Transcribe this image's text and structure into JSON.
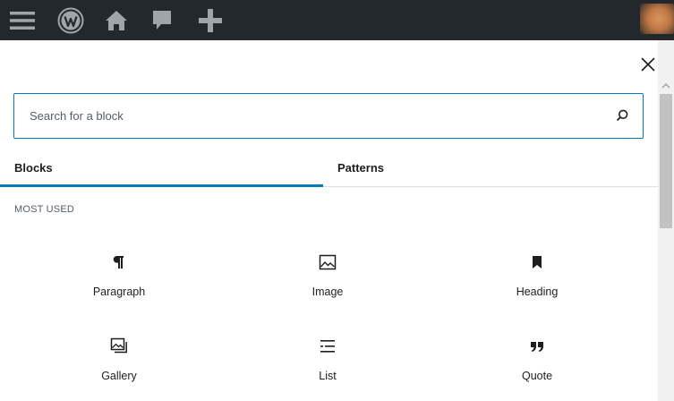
{
  "admin_bar": {
    "icons": [
      "menu-icon",
      "wordpress-logo-icon",
      "home-icon",
      "comment-icon",
      "plus-icon"
    ]
  },
  "inserter": {
    "close_icon": "close-icon",
    "search": {
      "placeholder": "Search for a block",
      "value": "",
      "icon": "search-icon"
    },
    "tabs": [
      {
        "label": "Blocks",
        "active": true
      },
      {
        "label": "Patterns",
        "active": false
      }
    ],
    "section_title": "MOST USED",
    "blocks": [
      {
        "label": "Paragraph",
        "icon": "paragraph-icon"
      },
      {
        "label": "Image",
        "icon": "image-icon"
      },
      {
        "label": "Heading",
        "icon": "heading-icon"
      },
      {
        "label": "Gallery",
        "icon": "gallery-icon"
      },
      {
        "label": "List",
        "icon": "list-icon"
      },
      {
        "label": "Quote",
        "icon": "quote-icon"
      }
    ]
  },
  "colors": {
    "admin_bar_bg": "#23282d",
    "accent": "#007cba",
    "text": "#1e1e1e"
  }
}
